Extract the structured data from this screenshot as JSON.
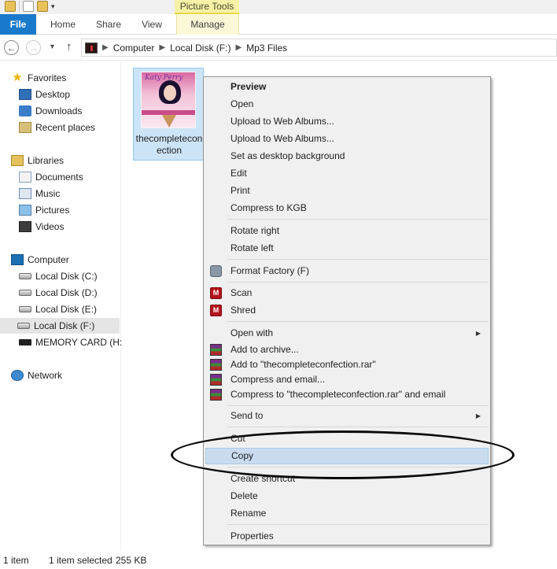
{
  "ribbon": {
    "contextual_group": "Picture Tools",
    "tabs": {
      "file": "File",
      "home": "Home",
      "share": "Share",
      "view": "View",
      "manage": "Manage"
    }
  },
  "address": {
    "crumbs": [
      "Computer",
      "Local Disk (F:)",
      "Mp3 Files"
    ]
  },
  "nav": {
    "favorites": "Favorites",
    "desktop": "Desktop",
    "downloads": "Downloads",
    "recent_places": "Recent places",
    "libraries": "Libraries",
    "documents": "Documents",
    "music": "Music",
    "pictures": "Pictures",
    "videos": "Videos",
    "computer": "Computer",
    "disk_c": "Local Disk (C:)",
    "disk_d": "Local Disk (D:)",
    "disk_e": "Local Disk (E:)",
    "disk_f": "Local Disk (F:)",
    "memory_card": "MEMORY CARD (H:)",
    "network": "Network"
  },
  "file": {
    "name": "thecompleteconfection",
    "name_line1": "thecompletecon",
    "name_line2": "ection"
  },
  "menu": {
    "preview": "Preview",
    "open": "Open",
    "upload1": "Upload to Web Albums...",
    "upload2": "Upload to Web Albums...",
    "set_bg": "Set as desktop background",
    "edit": "Edit",
    "print": "Print",
    "compress_kgb": "Compress to KGB",
    "rotate_right": "Rotate right",
    "rotate_left": "Rotate left",
    "format_factory": "Format Factory (F)",
    "scan": "Scan",
    "shred": "Shred",
    "open_with": "Open with",
    "add_archive": "Add to archive...",
    "add_rar": "Add to \"thecompleteconfection.rar\"",
    "compress_email": "Compress and email...",
    "compress_rar_email": "Compress to \"thecompleteconfection.rar\" and email",
    "send_to": "Send to",
    "cut": "Cut",
    "copy": "Copy",
    "create_shortcut": "Create shortcut",
    "delete": "Delete",
    "rename": "Rename",
    "properties": "Properties"
  },
  "status": {
    "count": "1 item",
    "selected": "1 item selected",
    "size": "255 KB"
  },
  "colors": {
    "file_tab": "#1979ca",
    "selection": "#cce4f7",
    "menu_highlight": "#c9dcef",
    "picture_tools": "#f6f1a6"
  }
}
